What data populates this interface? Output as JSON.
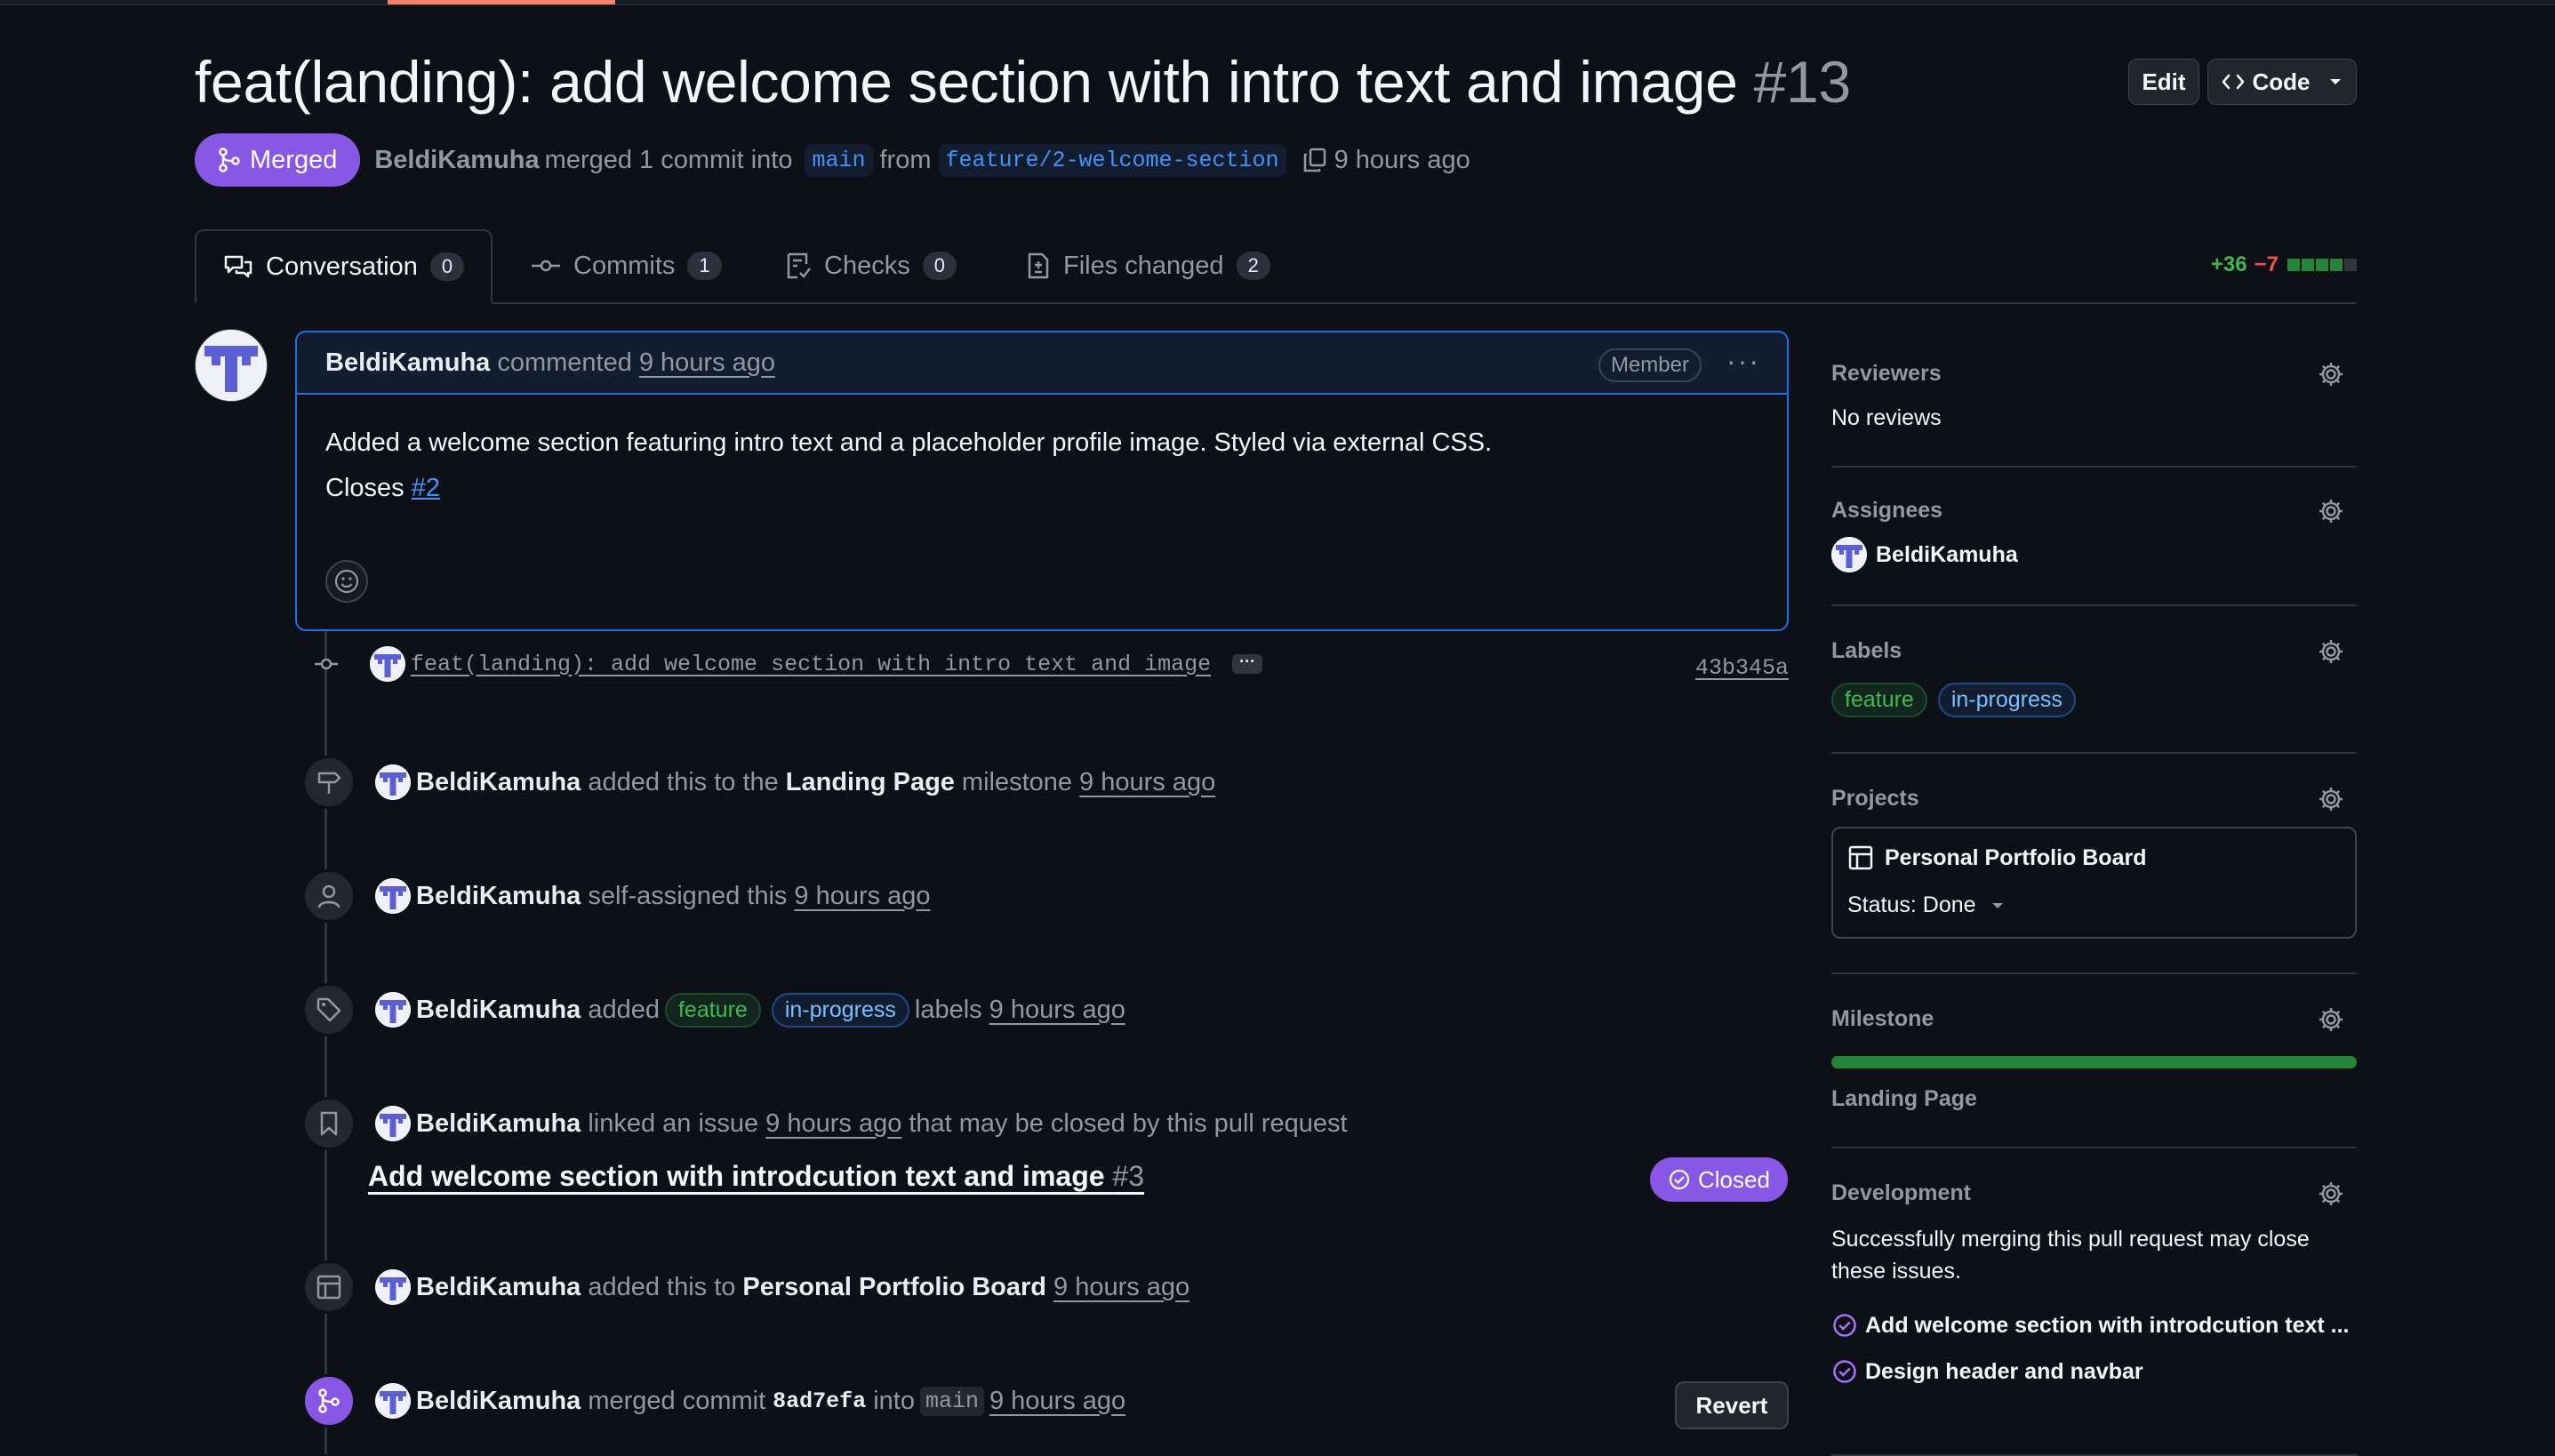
{
  "pr": {
    "title": "feat(landing): add welcome section with intro text and image",
    "number": "#13",
    "state": "Merged",
    "author": "BeldiKamuha",
    "merged_text": "merged 1 commit into",
    "base_branch": "main",
    "from_text": "from",
    "head_branch": "feature/2-welcome-section",
    "time": "9 hours ago"
  },
  "header": {
    "edit_label": "Edit",
    "code_label": "Code"
  },
  "tabs": [
    {
      "label": "Conversation",
      "count": "0"
    },
    {
      "label": "Commits",
      "count": "1"
    },
    {
      "label": "Checks",
      "count": "0"
    },
    {
      "label": "Files changed",
      "count": "2"
    }
  ],
  "diffstat": {
    "additions": "+36",
    "deletions": "−7"
  },
  "comment": {
    "author": "BeldiKamuha",
    "action": "commented",
    "time": "9 hours ago",
    "role": "Member",
    "body": "Added a welcome section featuring intro text and a placeholder profile image. Styled via external CSS.",
    "closes_label": "Closes",
    "closes_ref": "#2"
  },
  "timeline": {
    "commit": {
      "message": "feat(landing): add welcome section with intro text and image",
      "sha": "43b345a"
    },
    "milestone": {
      "user": "BeldiKamuha",
      "text1": "added this to the",
      "milestone": "Landing Page",
      "text2": "milestone",
      "time": "9 hours ago"
    },
    "assign": {
      "user": "BeldiKamuha",
      "text": "self-assigned this",
      "time": "9 hours ago"
    },
    "labels": {
      "user": "BeldiKamuha",
      "text1": "added",
      "label1": "feature",
      "label2": "in-progress",
      "text2": "labels",
      "time": "9 hours ago"
    },
    "linked": {
      "user": "BeldiKamuha",
      "text1": "linked an issue",
      "time": "9 hours ago",
      "text2": "that may be closed by this pull request",
      "issue_title": "Add welcome section with introdcution text and image",
      "issue_num": "#3",
      "issue_state": "Closed"
    },
    "project": {
      "user": "BeldiKamuha",
      "text": "added this to",
      "project": "Personal Portfolio Board",
      "time": "9 hours ago"
    },
    "merge": {
      "user": "BeldiKamuha",
      "text1": "merged commit",
      "sha": "8ad7efa",
      "text2": "into",
      "branch": "main",
      "time": "9 hours ago",
      "revert_label": "Revert"
    }
  },
  "sidebar": {
    "reviewers": {
      "title": "Reviewers",
      "value": "No reviews"
    },
    "assignees": {
      "title": "Assignees",
      "user": "BeldiKamuha"
    },
    "labels": {
      "title": "Labels",
      "items": [
        "feature",
        "in-progress"
      ]
    },
    "projects": {
      "title": "Projects",
      "board": "Personal Portfolio Board",
      "status": "Status: Done"
    },
    "milestone": {
      "title": "Milestone",
      "name": "Landing Page",
      "progress": 1.0
    },
    "development": {
      "title": "Development",
      "description": "Successfully merging this pull request may close these issues.",
      "issues": [
        "Add welcome section with introdcution text ...",
        "Design header and navbar"
      ]
    }
  }
}
